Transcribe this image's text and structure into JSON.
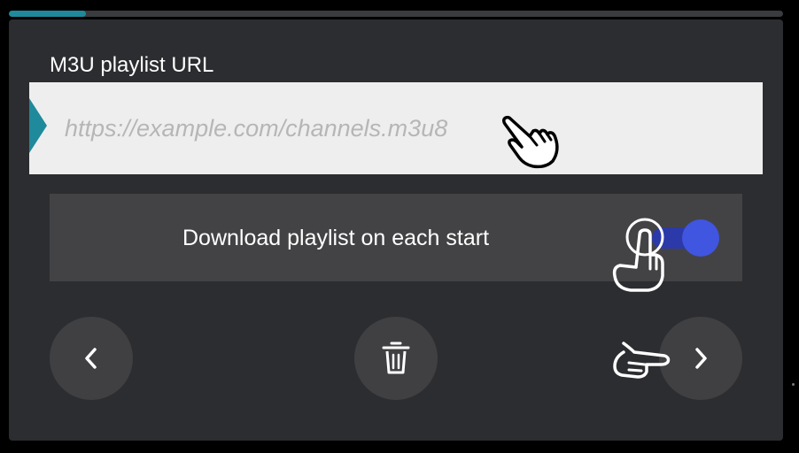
{
  "progress": {
    "value_percent": 10,
    "color": "#1f8a9b"
  },
  "form": {
    "url_label": "M3U playlist URL",
    "url_value": "",
    "url_placeholder": "https://example.com/channels.m3u8",
    "download_toggle": {
      "label": "Download playlist on each start",
      "checked": true,
      "color": "#4055e0"
    }
  },
  "buttons": {
    "back_icon": "chevron-left-icon",
    "delete_icon": "trash-icon",
    "next_icon": "chevron-right-icon"
  },
  "overlays": {
    "pointer_hands": [
      "hand-pointer-icon",
      "hand-tap-icon",
      "hand-point-right-icon"
    ]
  }
}
